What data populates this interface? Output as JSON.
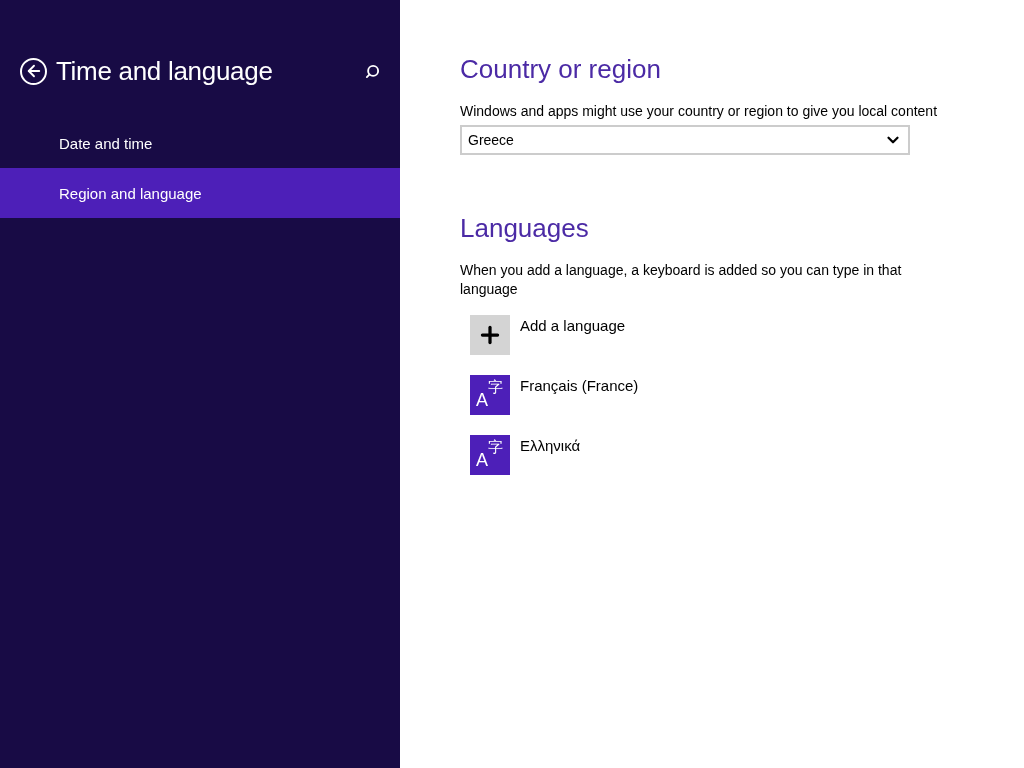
{
  "sidebar": {
    "title": "Time and language",
    "items": [
      {
        "label": "Date and time",
        "selected": false
      },
      {
        "label": "Region and language",
        "selected": true
      }
    ]
  },
  "country": {
    "heading": "Country or region",
    "description": "Windows and apps might use your country or region to give you local content",
    "value": "Greece"
  },
  "languages": {
    "heading": "Languages",
    "description": "When you add a language, a keyboard is added so you can type in that language",
    "items": [
      {
        "kind": "add",
        "label": "Add a language"
      },
      {
        "kind": "language",
        "label": "Français (France)",
        "glyph_latin": "A",
        "glyph_cjk": "字"
      },
      {
        "kind": "language",
        "label": "Ελληνικά",
        "glyph_latin": "A",
        "glyph_cjk": "字"
      }
    ]
  }
}
